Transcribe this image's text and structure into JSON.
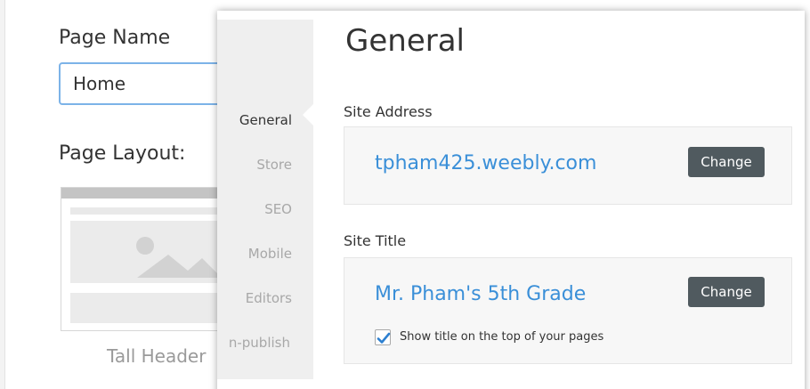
{
  "page_settings": {
    "page_name_label": "Page Name",
    "page_name_value": "Home",
    "page_layout_label": "Page Layout:",
    "layout_name": "Tall Header"
  },
  "dialog": {
    "title": "General",
    "nav": [
      {
        "label": "General",
        "active": true
      },
      {
        "label": "Store",
        "active": false
      },
      {
        "label": "SEO",
        "active": false
      },
      {
        "label": "Mobile",
        "active": false
      },
      {
        "label": "Editors",
        "active": false
      },
      {
        "label": "n-publish",
        "active": false
      }
    ],
    "site_address": {
      "label": "Site Address",
      "value": "tpham425.weebly.com",
      "button": "Change"
    },
    "site_title": {
      "label": "Site Title",
      "value": "Mr. Pham's 5th Grade",
      "button": "Change",
      "checkbox_label": "Show title on the top of your pages",
      "checkbox_checked": true
    }
  },
  "colors": {
    "accent_link": "#3a8fd8",
    "button_bg": "#505a5f",
    "input_border": "#7cb3e8",
    "checkbox_check": "#2c7fd0"
  }
}
